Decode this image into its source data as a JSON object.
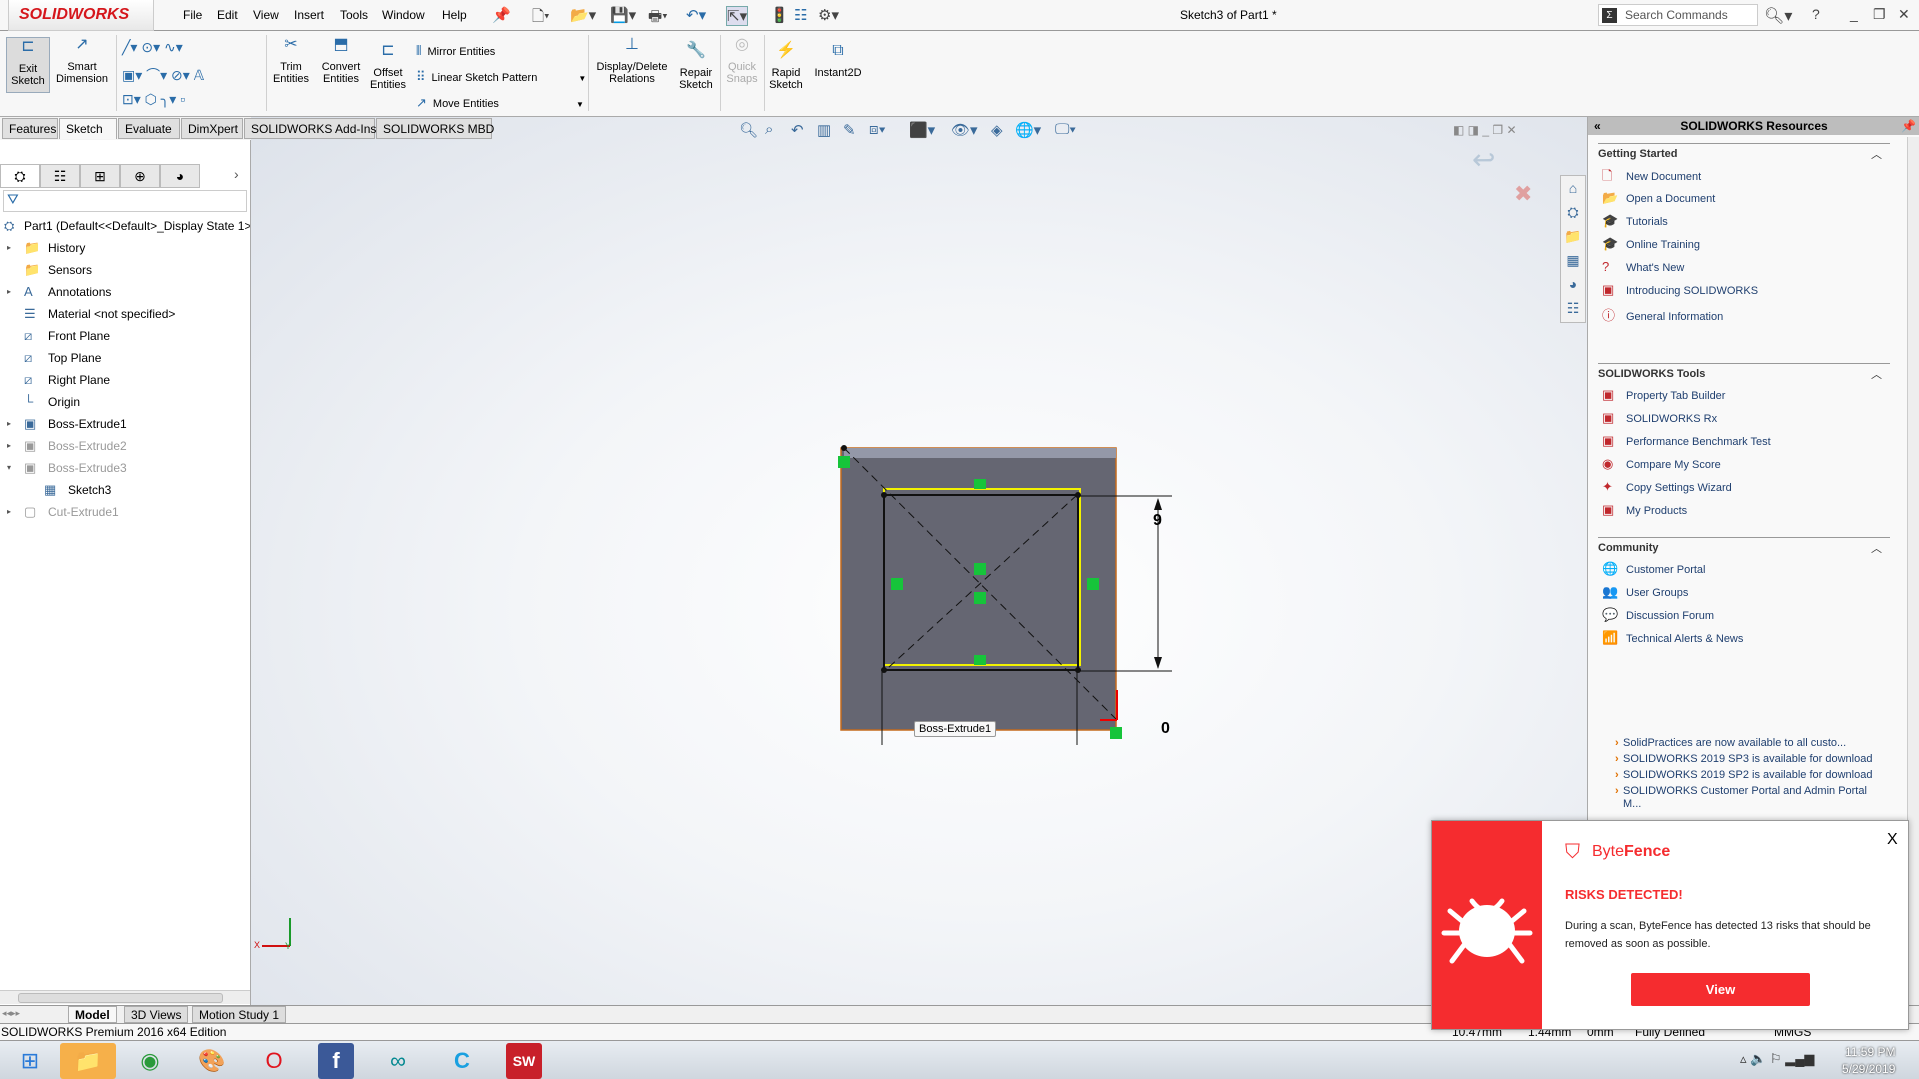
{
  "app": {
    "brand": "SOLIDWORKS",
    "title": "Sketch3 of Part1 *",
    "search_placeholder": "Search Commands",
    "help": "?"
  },
  "menu": [
    "File",
    "Edit",
    "View",
    "Insert",
    "Tools",
    "Window",
    "Help"
  ],
  "commands": {
    "exit_sketch": "Exit Sketch",
    "smart_dimension": "Smart Dimension",
    "trim": "Trim Entities",
    "convert": "Convert Entities",
    "offset": "Offset Entities",
    "mirror": "Mirror Entities",
    "linear_pattern": "Linear Sketch Pattern",
    "move": "Move Entities",
    "display_relations": "Display/Delete Relations",
    "repair": "Repair Sketch",
    "quick_snaps": "Quick Snaps",
    "rapid": "Rapid Sketch",
    "instant2d": "Instant2D"
  },
  "tabs": [
    "Features",
    "Sketch",
    "Evaluate",
    "DimXpert",
    "SOLIDWORKS Add-Ins",
    "SOLIDWORKS MBD"
  ],
  "active_tab": "Sketch",
  "tree": {
    "root": "Part1  (Default<<Default>_Display State 1>",
    "items": [
      {
        "label": "History",
        "arrow": "▸",
        "icon": "📁"
      },
      {
        "label": "Sensors",
        "arrow": "",
        "icon": "📁"
      },
      {
        "label": "Annotations",
        "arrow": "▸",
        "icon": "A"
      },
      {
        "label": "Material <not specified>",
        "arrow": "",
        "icon": "☰"
      },
      {
        "label": "Front Plane",
        "arrow": "",
        "icon": "⧄"
      },
      {
        "label": "Top Plane",
        "arrow": "",
        "icon": "⧄"
      },
      {
        "label": "Right Plane",
        "arrow": "",
        "icon": "⧄"
      },
      {
        "label": "Origin",
        "arrow": "",
        "icon": "└"
      },
      {
        "label": "Boss-Extrude1",
        "arrow": "▸",
        "icon": "▣"
      },
      {
        "label": "Boss-Extrude2",
        "arrow": "▸",
        "icon": "▣",
        "dim": true
      },
      {
        "label": "Boss-Extrude3",
        "arrow": "▾",
        "icon": "▣",
        "dim": true
      },
      {
        "label": "Sketch3",
        "arrow": "",
        "icon": "▦",
        "indent": true
      },
      {
        "label": "Cut-Extrude1",
        "arrow": "▸",
        "icon": "▢",
        "dim": true
      }
    ]
  },
  "viewport": {
    "dimension": "9",
    "tooltip": "Boss-Extrude1",
    "bottom_dim": "0",
    "triad_x": "X",
    "triad_y": "Y"
  },
  "bottom_tabs": [
    "Model",
    "3D Views",
    "Motion Study 1"
  ],
  "status": {
    "edition": "SOLIDWORKS Premium 2016 x64 Edition",
    "x": "10.47mm",
    "y": "1.44mm",
    "z": "0mm",
    "state": "Fully Defined",
    "units": "MMGS"
  },
  "resources": {
    "title": "SOLIDWORKS Resources",
    "sections": [
      {
        "title": "Getting Started",
        "items": [
          "New Document",
          "Open a Document",
          "Tutorials",
          "Online Training",
          "What's New",
          "Introducing SOLIDWORKS",
          "General Information"
        ]
      },
      {
        "title": "SOLIDWORKS Tools",
        "items": [
          "Property Tab Builder",
          "SOLIDWORKS Rx",
          "Performance Benchmark Test",
          "Compare My Score",
          "Copy Settings Wizard",
          "My Products"
        ]
      },
      {
        "title": "Community",
        "items": [
          "Customer Portal",
          "User Groups",
          "Discussion Forum",
          "Technical Alerts & News"
        ]
      }
    ],
    "news": [
      "SolidPractices are now available to all custo...",
      "SOLIDWORKS 2019 SP3 is available for download",
      "SOLIDWORKS 2019 SP2 is available for download",
      "SOLIDWORKS Customer Portal and Admin Portal M..."
    ]
  },
  "popup": {
    "brand_a": "Byte",
    "brand_b": "Fence",
    "heading": "RISKS DETECTED!",
    "body": "During a scan, ByteFence has detected 13 risks that should be removed as soon as possible.",
    "button": "View",
    "close": "X",
    "accent": "#f52c2f"
  },
  "clock": {
    "time": "11:59 PM",
    "date": "5/29/2019"
  }
}
